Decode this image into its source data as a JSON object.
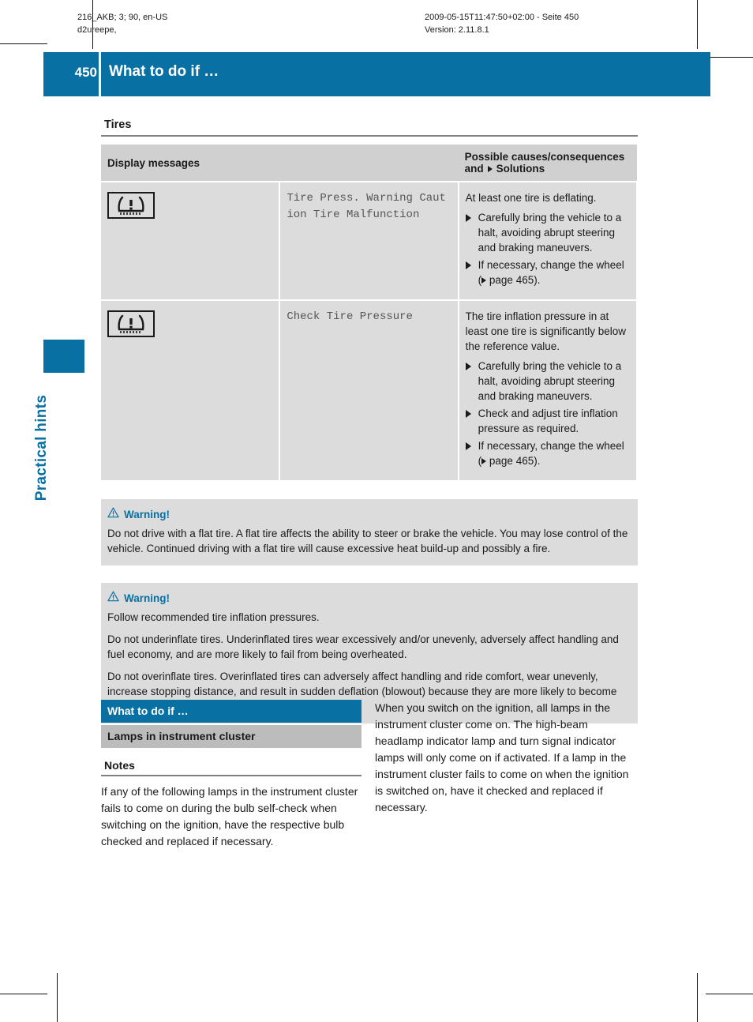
{
  "runhead": {
    "left_line1": "216_AKB; 3; 90, en-US",
    "left_line2": "d2ureepe,",
    "right_line1": "2009-05-15T11:47:50+02:00 - Seite 450",
    "right_line2": "Version: 2.11.8.1"
  },
  "page_header": {
    "page_number": "450",
    "title": "What to do if …",
    "accent_color": "#0870a2"
  },
  "chapter_tab": {
    "label": "Practical hints"
  },
  "section": {
    "title": "Tires"
  },
  "table": {
    "headers": {
      "col1": "Display messages",
      "col2_prefix": "Possible causes/consequences and",
      "col2_suffix": "Solutions"
    },
    "rows": [
      {
        "icon_name": "tire-pressure-warning-icon",
        "display_message": "Tire Press. Warning Caution Tire Malfunction",
        "cause": "At least one tire is deflating.",
        "solutions": [
          {
            "text_before": "Carefully bring the vehicle to a halt, avoiding abrupt steering and braking maneuvers.",
            "has_xref": false,
            "text_after": ""
          },
          {
            "text_before": "If necessary, change the wheel (",
            "has_xref": true,
            "text_after": " page 465)."
          }
        ]
      },
      {
        "icon_name": "tire-pressure-warning-icon",
        "display_message": "Check Tire Pressure",
        "cause": "The tire inflation pressure in at least one tire is significantly below the reference value.",
        "solutions": [
          {
            "text_before": "Carefully bring the vehicle to a halt, avoiding abrupt steering and braking maneuvers.",
            "has_xref": false,
            "text_after": ""
          },
          {
            "text_before": "Check and adjust tire inflation pressure as required.",
            "has_xref": false,
            "text_after": ""
          },
          {
            "text_before": "If necessary, change the wheel (",
            "has_xref": true,
            "text_after": " page 465)."
          }
        ]
      }
    ]
  },
  "warnings": [
    {
      "heading": "Warning!",
      "paragraphs": [
        "Do not drive with a flat tire. A flat tire affects the ability to steer or brake the vehicle. You may lose control of the vehicle. Continued driving with a flat tire will cause excessive heat build-up and possibly a fire."
      ]
    },
    {
      "heading": "Warning!",
      "paragraphs": [
        "Follow recommended tire inflation pressures.",
        "Do not underinflate tires. Underinflated tires wear excessively and/or unevenly, adversely affect handling and fuel economy, and are more likely to fail from being overheated.",
        "Do not overinflate tires. Overinflated tires can adversely affect handling and ride comfort, wear unevenly, increase stopping distance, and result in sudden deflation (blowout) because they are more likely to become punctured or damaged by road debris, potholes etc."
      ]
    }
  ],
  "bottom": {
    "blue_bar": "What to do if …",
    "gray_bar": "Lamps in instrument cluster",
    "notes_title": "Notes",
    "left_text": "If any of the following lamps in the instrument cluster fails to come on during the bulb self-check when switching on the ignition, have the respective bulb checked and replaced if necessary.",
    "right_text": "When you switch on the ignition, all lamps in the instrument cluster come on. The high-beam headlamp indicator lamp and turn signal indicator lamps will only come on if activated. If a lamp in the instrument cluster fails to come on when the ignition is switched on, have it checked and replaced if necessary."
  }
}
